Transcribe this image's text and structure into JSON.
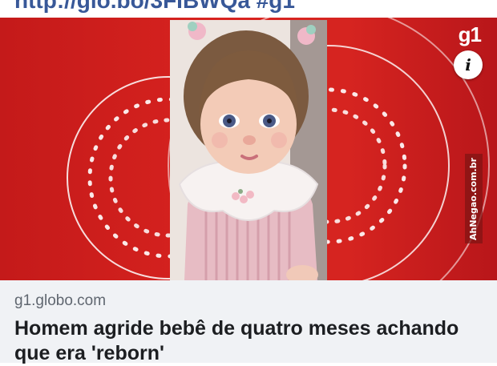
{
  "post": {
    "link_text": "http://glo.bo/3FIBWQa #g1"
  },
  "media": {
    "logo_text": "g1",
    "info_icon": "info-icon",
    "info_glyph": "i",
    "watermark": "AhNegao.com.br",
    "image_subject": "doll-photo",
    "colors": {
      "brand_red": "#d8231f",
      "ring_white": "#ffffff"
    }
  },
  "link_card": {
    "domain": "g1.globo.com",
    "headline": "Homem agride bebê de quatro meses achando que era 'reborn'"
  }
}
